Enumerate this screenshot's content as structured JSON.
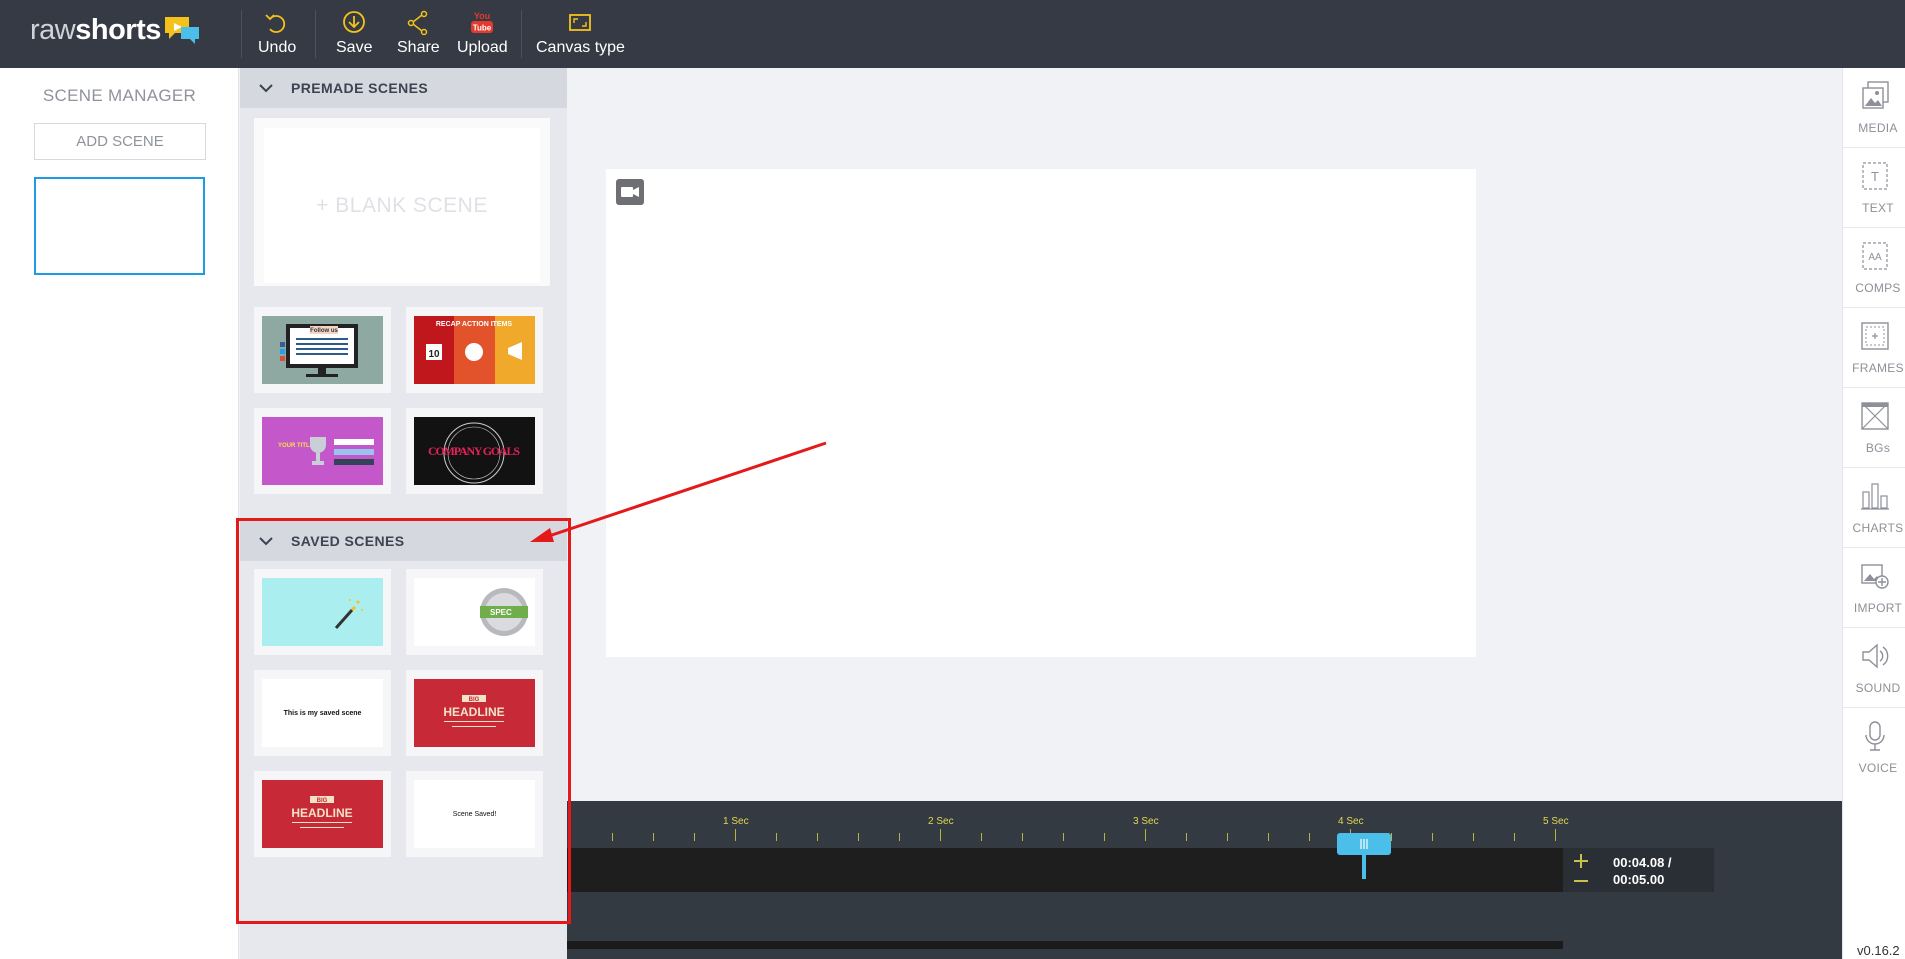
{
  "brand": {
    "logo_part1": "raw",
    "logo_part2": "shorts"
  },
  "toolbar": {
    "undo": "Undo",
    "save": "Save",
    "share": "Share",
    "upload": "Upload",
    "youtube_badge_top": "You",
    "youtube_badge_bottom": "Tube",
    "canvas_type": "Canvas type"
  },
  "scene_manager": {
    "title": "SCENE MANAGER",
    "add_scene": "ADD SCENE"
  },
  "premade": {
    "header": "PREMADE SCENES",
    "blank_scene": "+ BLANK SCENE",
    "tiles": [
      {
        "name": "follow-us-monitor",
        "text": "Follow us",
        "bg": "#8da9a1"
      },
      {
        "name": "recap-action-items",
        "text": "RECAP ACTION ITEMS",
        "bg": "#b5181c"
      },
      {
        "name": "your-title-trophy",
        "text": "YOUR TITLE",
        "bg": "#c457c9"
      },
      {
        "name": "company-goals",
        "text": "COMPANY GOALS",
        "bg": "#121212"
      }
    ]
  },
  "saved": {
    "header": "SAVED SCENES",
    "tiles": [
      {
        "name": "magic-wand",
        "text": "",
        "bg": "#aaeeef"
      },
      {
        "name": "spec-badge",
        "text": "SPEC",
        "bg": "#ffffff"
      },
      {
        "name": "my-saved-scene",
        "text": "This is my saved scene",
        "bg": "#ffffff"
      },
      {
        "name": "big-headline-1",
        "text_top": "BIG",
        "text": "HEADLINE",
        "bg": "#c72a36"
      },
      {
        "name": "big-headline-2",
        "text_top": "BIG",
        "text": "HEADLINE",
        "bg": "#c72a36"
      },
      {
        "name": "scene-saved",
        "text": "Scene Saved!",
        "bg": "#ffffff"
      }
    ]
  },
  "right_bar": [
    {
      "label": "MEDIA",
      "icon": "media-icon"
    },
    {
      "label": "TEXT",
      "icon": "text-icon"
    },
    {
      "label": "COMPS",
      "icon": "comps-icon"
    },
    {
      "label": "FRAMES",
      "icon": "frames-icon"
    },
    {
      "label": "BGs",
      "icon": "backgrounds-icon"
    },
    {
      "label": "CHARTS",
      "icon": "charts-icon"
    },
    {
      "label": "IMPORT",
      "icon": "import-icon"
    },
    {
      "label": "SOUND",
      "icon": "sound-icon"
    },
    {
      "label": "VOICE",
      "icon": "voice-icon"
    }
  ],
  "timeline": {
    "marks": [
      "1 Sec",
      "2 Sec",
      "3 Sec",
      "4 Sec",
      "5 Sec"
    ],
    "current_time": "00:04.08 /",
    "total_time": "00:05.00"
  },
  "version": "v0.16.2",
  "colors": {
    "accent": "#1f9be6",
    "topbar": "#353a44",
    "annotation": "#e4191a",
    "playhead": "#4bbfe9"
  }
}
